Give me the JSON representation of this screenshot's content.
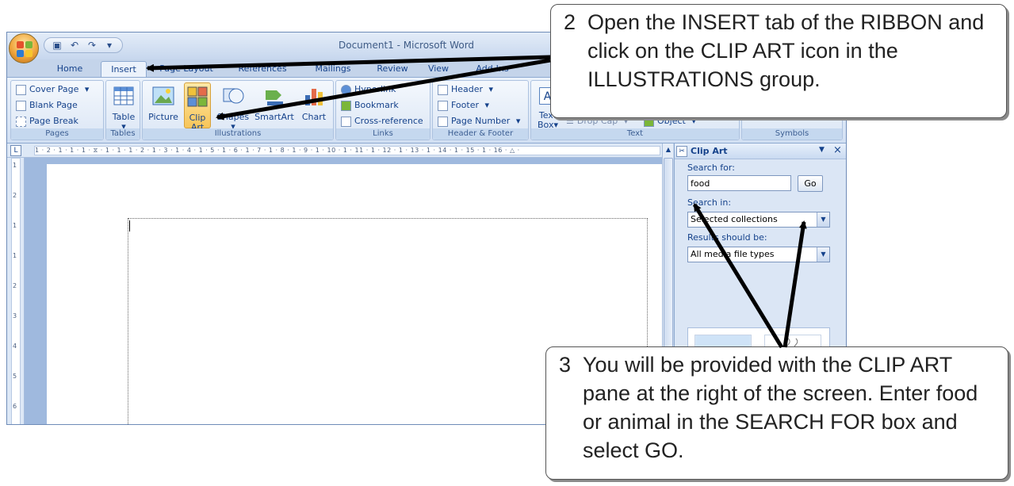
{
  "window": {
    "title": "Document1 - Microsoft Word"
  },
  "quick_access": {
    "save_icon": "save-icon",
    "undo_icon": "undo-icon",
    "redo_icon": "redo-icon"
  },
  "tabs": [
    {
      "label": "Home"
    },
    {
      "label": "Insert"
    },
    {
      "label": "Page Layout"
    },
    {
      "label": "References"
    },
    {
      "label": "Mailings"
    },
    {
      "label": "Review"
    },
    {
      "label": "View"
    },
    {
      "label": "Add-Ins"
    }
  ],
  "ribbon": {
    "pages": {
      "label": "Pages",
      "cover_page": "Cover Page",
      "blank_page": "Blank Page",
      "page_break": "Page Break"
    },
    "tables": {
      "label": "Tables",
      "table": "Table"
    },
    "illustrations": {
      "label": "Illustrations",
      "picture": "Picture",
      "clip_art_1": "Clip",
      "clip_art_2": "Art",
      "shapes": "Shapes",
      "smartart": "SmartArt",
      "chart": "Chart"
    },
    "links": {
      "label": "Links",
      "hyperlink": "Hyperlink",
      "bookmark": "Bookmark",
      "cross_reference": "Cross-reference"
    },
    "header_footer": {
      "label": "Header & Footer",
      "header": "Header",
      "footer": "Footer",
      "page_number": "Page Number"
    },
    "text": {
      "label": "Text",
      "text_box_1": "Text",
      "text_box_2": "Box",
      "drop_cap": "Drop Cap",
      "object": "Object"
    },
    "symbols": {
      "label": "Symbols"
    }
  },
  "ruler": {
    "corner": "L",
    "ticks": "1 · 2 · 1 · 1 · 1 · ⧖ · 1 · 1 · 1 · 2 · 1 · 3 · 1 · 4 · 1 · 5 · 1 · 6 · 1 · 7 · 1 · 8 · 1 · 9 · 1 · 10 · 1 · 11 · 1 · 12 · 1 · 13 · 1 · 14 · 1 · 15 · 1 · 16 · △ ·"
  },
  "vruler": [
    "1",
    "2",
    "1",
    "1",
    "2",
    "3",
    "4",
    "5",
    "6"
  ],
  "clip_art_pane": {
    "title": "Clip Art",
    "search_for_label": "Search for:",
    "search_value": "food",
    "go_label": "Go",
    "search_in_label": "Search in:",
    "search_in_value": "Selected collections",
    "results_label": "Results should be:",
    "results_value": "All media file types"
  },
  "callouts": {
    "step2": {
      "number": "2",
      "text": "Open the INSERT tab of the RIBBON and click on the CLIP ART icon in the ILLUSTRATIONS group."
    },
    "step3": {
      "number": "3",
      "text": "You will be provided with the CLIP ART pane at the right of the screen. Enter food or animal in the SEARCH FOR box and select GO."
    }
  },
  "colors": {
    "ribbon_blue": "#15428b",
    "active_button": "#f7c55a"
  }
}
